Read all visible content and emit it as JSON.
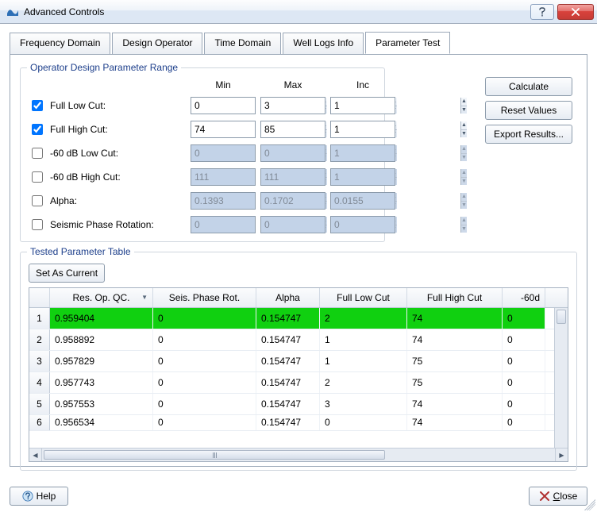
{
  "window": {
    "title": "Advanced Controls"
  },
  "tabs": [
    {
      "label": "Frequency Domain"
    },
    {
      "label": "Design Operator"
    },
    {
      "label": "Time Domain"
    },
    {
      "label": "Well Logs Info"
    },
    {
      "label": "Parameter Test"
    }
  ],
  "active_tab": 4,
  "group1": {
    "legend": "Operator Design Parameter Range",
    "cols": {
      "min": "Min",
      "max": "Max",
      "inc": "Inc"
    },
    "rows": [
      {
        "checked": true,
        "enabled": true,
        "label": "Full Low Cut:",
        "min": "0",
        "max": "3",
        "inc": "1"
      },
      {
        "checked": true,
        "enabled": true,
        "label": "Full High Cut:",
        "min": "74",
        "max": "85",
        "inc": "1"
      },
      {
        "checked": false,
        "enabled": false,
        "label": "-60 dB Low Cut:",
        "min": "0",
        "max": "0",
        "inc": "1"
      },
      {
        "checked": false,
        "enabled": false,
        "label": "-60 dB High Cut:",
        "min": "111",
        "max": "111",
        "inc": "1"
      },
      {
        "checked": false,
        "enabled": false,
        "label": "Alpha:",
        "min": "0.1393",
        "max": "0.1702",
        "inc": "0.0155"
      },
      {
        "checked": false,
        "enabled": false,
        "label": "Seismic Phase Rotation:",
        "min": "0",
        "max": "0",
        "inc": "0"
      }
    ]
  },
  "actions": {
    "calculate": "Calculate",
    "reset": "Reset Values",
    "export": "Export Results..."
  },
  "group2": {
    "legend": "Tested Parameter Table",
    "setAsCurrent": "Set As Current",
    "columns": [
      "Res. Op. QC.",
      "Seis. Phase Rot.",
      "Alpha",
      "Full Low Cut",
      "Full High Cut",
      "-60d"
    ],
    "sort_col": 0,
    "sort_dir": "desc",
    "selected_row": 0,
    "rows": [
      {
        "n": "1",
        "resop": "0.959404",
        "spr": "0",
        "alpha": "0.154747",
        "flc": "2",
        "fhc": "74",
        "m60": "0"
      },
      {
        "n": "2",
        "resop": "0.958892",
        "spr": "0",
        "alpha": "0.154747",
        "flc": "1",
        "fhc": "74",
        "m60": "0"
      },
      {
        "n": "3",
        "resop": "0.957829",
        "spr": "0",
        "alpha": "0.154747",
        "flc": "1",
        "fhc": "75",
        "m60": "0"
      },
      {
        "n": "4",
        "resop": "0.957743",
        "spr": "0",
        "alpha": "0.154747",
        "flc": "2",
        "fhc": "75",
        "m60": "0"
      },
      {
        "n": "5",
        "resop": "0.957553",
        "spr": "0",
        "alpha": "0.154747",
        "flc": "3",
        "fhc": "74",
        "m60": "0"
      },
      {
        "n": "6",
        "resop": "0.956534",
        "spr": "0",
        "alpha": "0.154747",
        "flc": "0",
        "fhc": "74",
        "m60": "0"
      }
    ]
  },
  "footer": {
    "help": "Help",
    "close": "Close"
  }
}
